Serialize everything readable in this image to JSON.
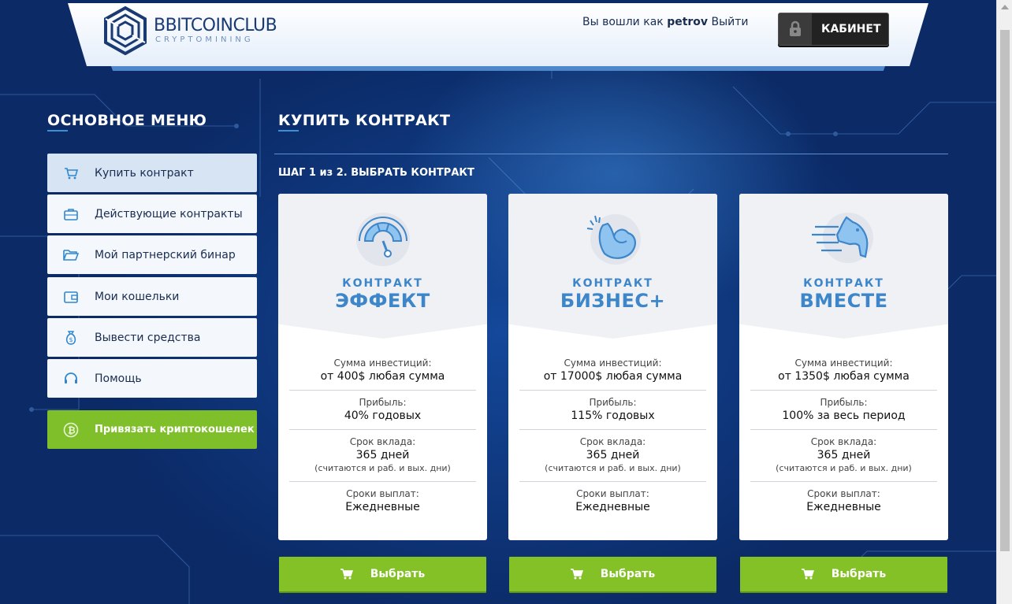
{
  "header": {
    "logo_name": "BBITCOINCLUB",
    "logo_sub": "CRYPTOMINING",
    "logged_in_prefix": "Вы вошли как",
    "username": "petrov",
    "logout": "Выйти",
    "cabinet": "КАБИНЕТ"
  },
  "sidebar": {
    "title": "ОСНОВНОЕ МЕНЮ",
    "items": [
      {
        "label": "Купить контракт",
        "icon": "cart-icon"
      },
      {
        "label": "Действующие контракты",
        "icon": "briefcase-icon"
      },
      {
        "label": "Мой партнерский бинар",
        "icon": "folder-icon"
      },
      {
        "label": "Мои кошельки",
        "icon": "wallet-icon"
      },
      {
        "label": "Вывести средства",
        "icon": "money-bag-icon"
      },
      {
        "label": "Помощь",
        "icon": "headset-icon"
      }
    ],
    "crypto_button": "Привязать криптокошелек"
  },
  "main": {
    "title": "КУПИТЬ КОНТРАКТ",
    "step": "ШАГ 1 из 2. ВЫБРАТЬ КОНТРАКТ",
    "cards": [
      {
        "kind": "КОНТРАКТ",
        "name": "ЭФФЕКТ",
        "icon": "speedometer-icon",
        "invest_label": "Сумма инвестиций:",
        "invest_value": "от 400$ любая сумма",
        "profit_label": "Прибыль:",
        "profit_value": "40% годовых",
        "term_label": "Срок вклада:",
        "term_value": "365 дней",
        "term_note": "(считаются и раб. и вых. дни)",
        "payout_label": "Сроки выплат:",
        "payout_value": "Ежедневные",
        "button": "Выбрать"
      },
      {
        "kind": "КОНТРАКТ",
        "name": "БИЗНЕС+",
        "icon": "muscle-arm-icon",
        "invest_label": "Сумма инвестиций:",
        "invest_value": "от 17000$ любая сумма",
        "profit_label": "Прибыль:",
        "profit_value": "115% годовых",
        "term_label": "Срок вклада:",
        "term_value": "365 дней",
        "term_note": "(считаются и раб. и вых. дни)",
        "payout_label": "Сроки выплат:",
        "payout_value": "Ежедневные",
        "button": "Выбрать"
      },
      {
        "kind": "КОНТРАКТ",
        "name": "ВМЕСТЕ",
        "icon": "horse-head-icon",
        "invest_label": "Сумма инвестиций:",
        "invest_value": "от 1350$ любая сумма",
        "profit_label": "Прибыль:",
        "profit_value": "100% за весь период",
        "term_label": "Срок вклада:",
        "term_value": "365 дней",
        "term_note": "(считаются и раб. и вых. дни)",
        "payout_label": "Сроки выплат:",
        "payout_value": "Ежедневные",
        "button": "Выбрать"
      }
    ]
  },
  "colors": {
    "background": "#0d3273",
    "accent_blue": "#3d86c9",
    "green": "#83c127",
    "text_dark": "#1a2d50"
  }
}
